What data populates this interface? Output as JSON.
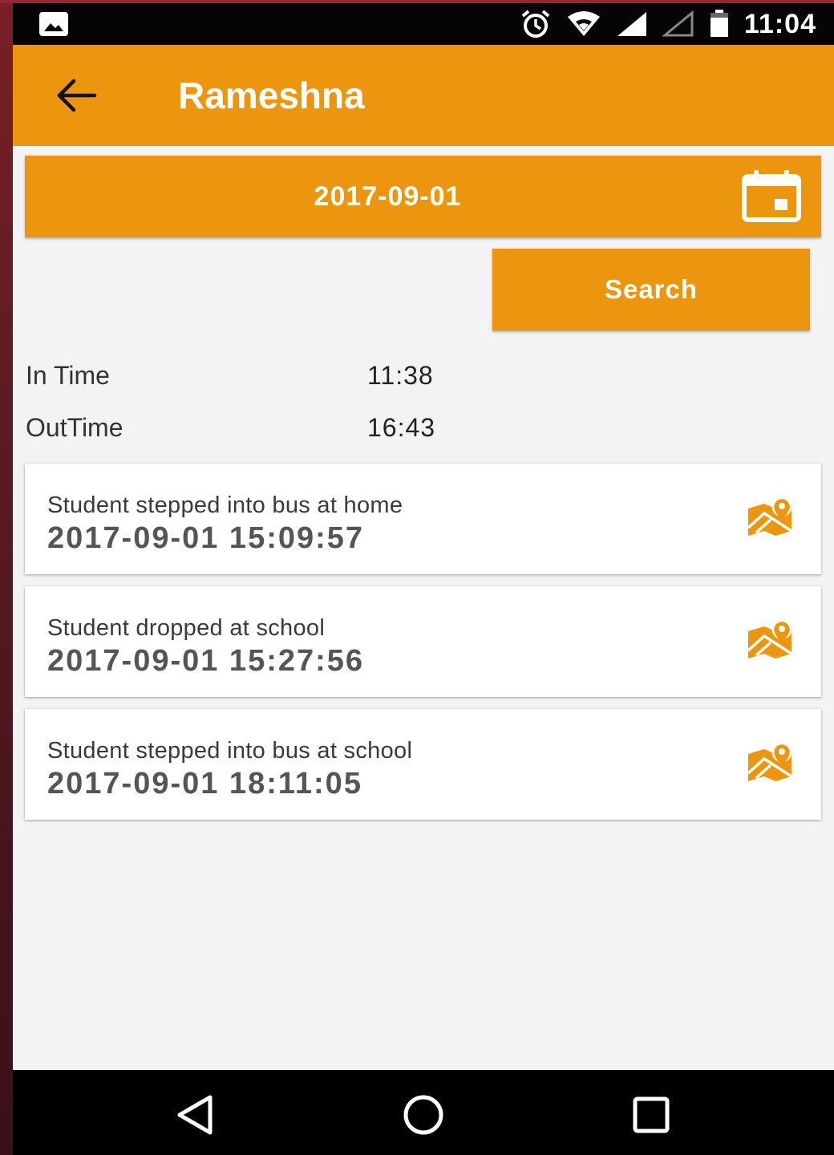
{
  "status_bar": {
    "time": "11:04"
  },
  "app_bar": {
    "title": "Rameshna"
  },
  "date_picker": {
    "value": "2017-09-01"
  },
  "search": {
    "label": "Search"
  },
  "attendance": {
    "in_time_label": "In Time",
    "in_time_value": "11:38",
    "out_time_label": "OutTime",
    "out_time_value": "16:43"
  },
  "events": [
    {
      "label": "Student stepped into bus at home",
      "timestamp": "2017-09-01 15:09:57"
    },
    {
      "label": "Student dropped at school",
      "timestamp": "2017-09-01 15:27:56"
    },
    {
      "label": "Student stepped into bus at school",
      "timestamp": "2017-09-01 18:11:05"
    }
  ],
  "icons": {
    "back": "arrow-left-icon",
    "calendar": "calendar-icon",
    "map": "map-pin-icon",
    "nav": [
      "back-triangle-icon",
      "home-circle-icon",
      "recents-square-icon"
    ]
  },
  "colors": {
    "accent": "#ec950f",
    "background": "#f3f3f3",
    "status_bar": "#050505"
  }
}
